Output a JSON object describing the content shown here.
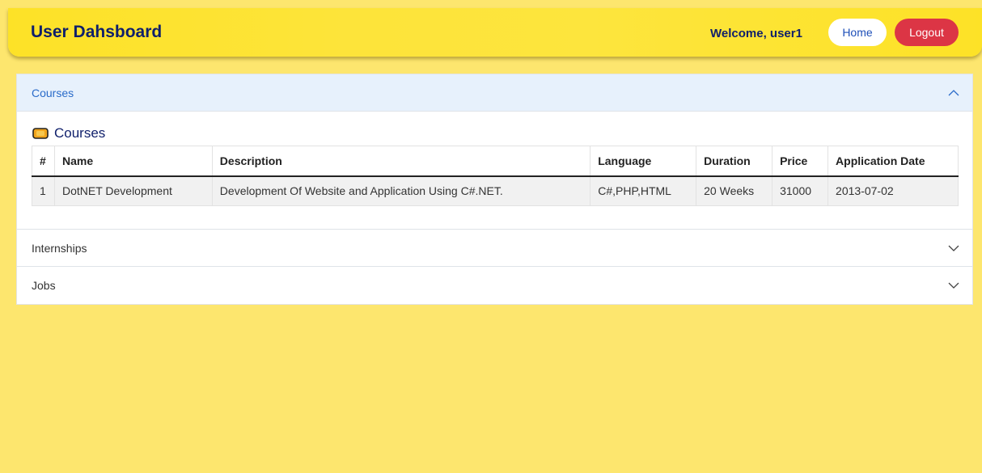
{
  "navbar": {
    "title": "User Dahsboard",
    "welcome": "Welcome, user1",
    "home_label": "Home",
    "logout_label": "Logout"
  },
  "accordion": {
    "items": [
      {
        "label": "Courses",
        "expanded": true
      },
      {
        "label": "Internships",
        "expanded": false
      },
      {
        "label": "Jobs",
        "expanded": false
      }
    ]
  },
  "courses": {
    "heading": "Courses",
    "icon": "book-icon",
    "columns": [
      "#",
      "Name",
      "Description",
      "Language",
      "Duration",
      "Price",
      "Application Date"
    ],
    "rows": [
      [
        "1",
        "DotNET Development",
        "Development Of Website and Application Using C#.NET.",
        "C#,PHP,HTML",
        "20 Weeks",
        "31000",
        "2013-07-02"
      ]
    ]
  },
  "colors": {
    "page_bg": "#fde66e",
    "navbar_bg": "#fde227",
    "title_color": "#0f1f6b",
    "logout_bg": "#dc3545",
    "active_header_bg": "#e7f1fc",
    "active_header_text": "#2a6bc9"
  }
}
